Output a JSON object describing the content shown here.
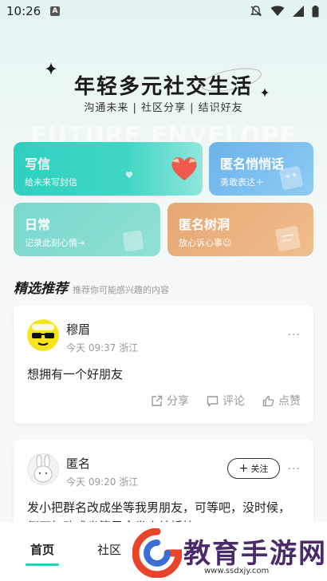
{
  "status": {
    "time": "10:26",
    "a_icon": "A"
  },
  "hero": {
    "title": "年轻多元社交生活",
    "subtitle": "沟通未来 | 社区分享 | 结识好友",
    "watermark": "FUTURE ENVELOPE"
  },
  "cards": {
    "letter": {
      "title": "写信",
      "desc": "给未来写封信"
    },
    "anon": {
      "title": "匿名悄悄话",
      "desc": "勇敢表达＋"
    },
    "daily": {
      "title": "日常",
      "desc": "记录此刻心情→"
    },
    "tree": {
      "title": "匿名树洞",
      "desc": "放心诉心事☺"
    }
  },
  "section": {
    "title": "精选推荐",
    "subtitle": "推荐你可能感兴趣的内容"
  },
  "posts": [
    {
      "name": "穆眉",
      "meta": "今天 09:37 浙江",
      "text": "想拥有一个好朋友",
      "share": "分享",
      "comment": "评论",
      "like": "点赞",
      "more": "···"
    },
    {
      "name": "匿名",
      "meta": "今天 09:20 浙江",
      "text": "发小把群名改成坐等我男朋友，可等吧，没时候，倒不如改成坐等早今发小结婚快",
      "follow": "关注",
      "more": "···"
    }
  ],
  "nav": {
    "home": "首页",
    "community": "社区"
  },
  "brand": {
    "name": "教育手游网",
    "url": "www.ssdxjy.com"
  },
  "colors": {
    "accent": "#2fc9b6",
    "letter_card": "#2fd0bf",
    "anon_card": "#6bb3ea",
    "daily_card": "#7ad8cb",
    "tree_card": "#e6a773"
  }
}
